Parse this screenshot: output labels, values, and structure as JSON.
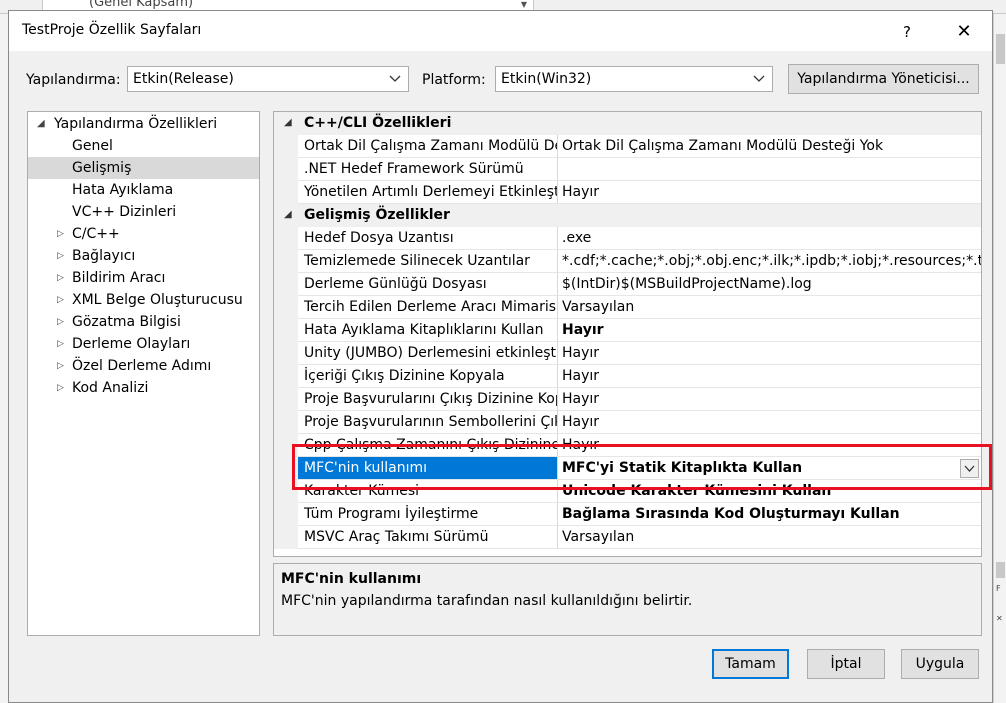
{
  "background": {
    "scope_combo": "(Genel Kapsam)"
  },
  "dialog": {
    "title": "TestProje Özellik Sayfaları",
    "help_glyph": "?",
    "close_glyph": "✕",
    "configuration_label": "Yapılandırma:",
    "configuration_value": "Etkin(Release)",
    "platform_label": "Platform:",
    "platform_value": "Etkin(Win32)",
    "config_manager_button": "Yapılandırma Yöneticisi..."
  },
  "tree": {
    "root": "Yapılandırma Özellikleri",
    "items": [
      {
        "label": "Genel",
        "expandable": false,
        "selected": false
      },
      {
        "label": "Gelişmiş",
        "expandable": false,
        "selected": true
      },
      {
        "label": "Hata Ayıklama",
        "expandable": false,
        "selected": false
      },
      {
        "label": "VC++ Dizinleri",
        "expandable": false,
        "selected": false
      },
      {
        "label": "C/C++",
        "expandable": true,
        "selected": false
      },
      {
        "label": "Bağlayıcı",
        "expandable": true,
        "selected": false
      },
      {
        "label": "Bildirim Aracı",
        "expandable": true,
        "selected": false
      },
      {
        "label": "XML Belge Oluşturucusu",
        "expandable": true,
        "selected": false
      },
      {
        "label": "Gözatma Bilgisi",
        "expandable": true,
        "selected": false
      },
      {
        "label": "Derleme Olayları",
        "expandable": true,
        "selected": false
      },
      {
        "label": "Özel Derleme Adımı",
        "expandable": true,
        "selected": false
      },
      {
        "label": "Kod Analizi",
        "expandable": true,
        "selected": false
      }
    ]
  },
  "grid": {
    "rows": [
      {
        "type": "category",
        "name": "C++/CLI Özellikleri"
      },
      {
        "type": "prop",
        "name": "Ortak Dil Çalışma Zamanı Modülü Desteği",
        "value": "Ortak Dil Çalışma Zamanı Modülü Desteği Yok",
        "bold": false
      },
      {
        "type": "prop",
        "name": ".NET Hedef Framework Sürümü",
        "value": "",
        "bold": false
      },
      {
        "type": "prop",
        "name": "Yönetilen Artımlı Derlemeyi Etkinleştir",
        "value": "Hayır",
        "bold": false
      },
      {
        "type": "category",
        "name": "Gelişmiş Özellikler"
      },
      {
        "type": "prop",
        "name": "Hedef Dosya Uzantısı",
        "value": ".exe",
        "bold": false
      },
      {
        "type": "prop",
        "name": "Temizlemede Silinecek Uzantılar",
        "value": "*.cdf;*.cache;*.obj;*.obj.enc;*.ilk;*.ipdb;*.iobj;*.resources;*.tlb;*.tli;*.t",
        "bold": false
      },
      {
        "type": "prop",
        "name": "Derleme Günlüğü Dosyası",
        "value": "$(IntDir)$(MSBuildProjectName).log",
        "bold": false
      },
      {
        "type": "prop",
        "name": "Tercih Edilen Derleme Aracı Mimarisi",
        "value": "Varsayılan",
        "bold": false
      },
      {
        "type": "prop",
        "name": "Hata Ayıklama Kitaplıklarını Kullan",
        "value": "Hayır",
        "bold": true
      },
      {
        "type": "prop",
        "name": "Unity (JUMBO) Derlemesini etkinleştir",
        "value": "Hayır",
        "bold": false
      },
      {
        "type": "prop",
        "name": "İçeriği Çıkış Dizinine Kopyala",
        "value": "Hayır",
        "bold": false
      },
      {
        "type": "prop",
        "name": "Proje Başvurularını Çıkış Dizinine Kopyala",
        "value": "Hayır",
        "bold": false
      },
      {
        "type": "prop",
        "name": "Proje Başvurularının Sembollerini Çıkış Dizinine Kopyala",
        "value": "Hayır",
        "bold": false
      },
      {
        "type": "prop",
        "name": "Cpp Çalışma Zamanını Çıkış Dizinine Kopyala",
        "value": "Hayır",
        "bold": false
      },
      {
        "type": "prop",
        "name": "MFC'nin kullanımı",
        "value": "MFC'yi Statik Kitaplıkta Kullan",
        "bold": true,
        "selected": true
      },
      {
        "type": "prop",
        "name": "Karakter Kümesi",
        "value": "Unicode Karakter Kümesini Kullan",
        "bold": true
      },
      {
        "type": "prop",
        "name": "Tüm Programı İyileştirme",
        "value": "Bağlama Sırasında Kod Oluşturmayı Kullan",
        "bold": true
      },
      {
        "type": "prop",
        "name": "MSVC Araç Takımı Sürümü",
        "value": "Varsayılan",
        "bold": false
      }
    ]
  },
  "description": {
    "title": "MFC'nin kullanımı",
    "text": "MFC'nin yapılandırma tarafından nasıl kullanıldığını belirtir."
  },
  "buttons": {
    "ok": "Tamam",
    "cancel": "İptal",
    "apply": "Uygula"
  },
  "colors": {
    "selection": "#0078d7",
    "highlight_box": "#e81123"
  }
}
